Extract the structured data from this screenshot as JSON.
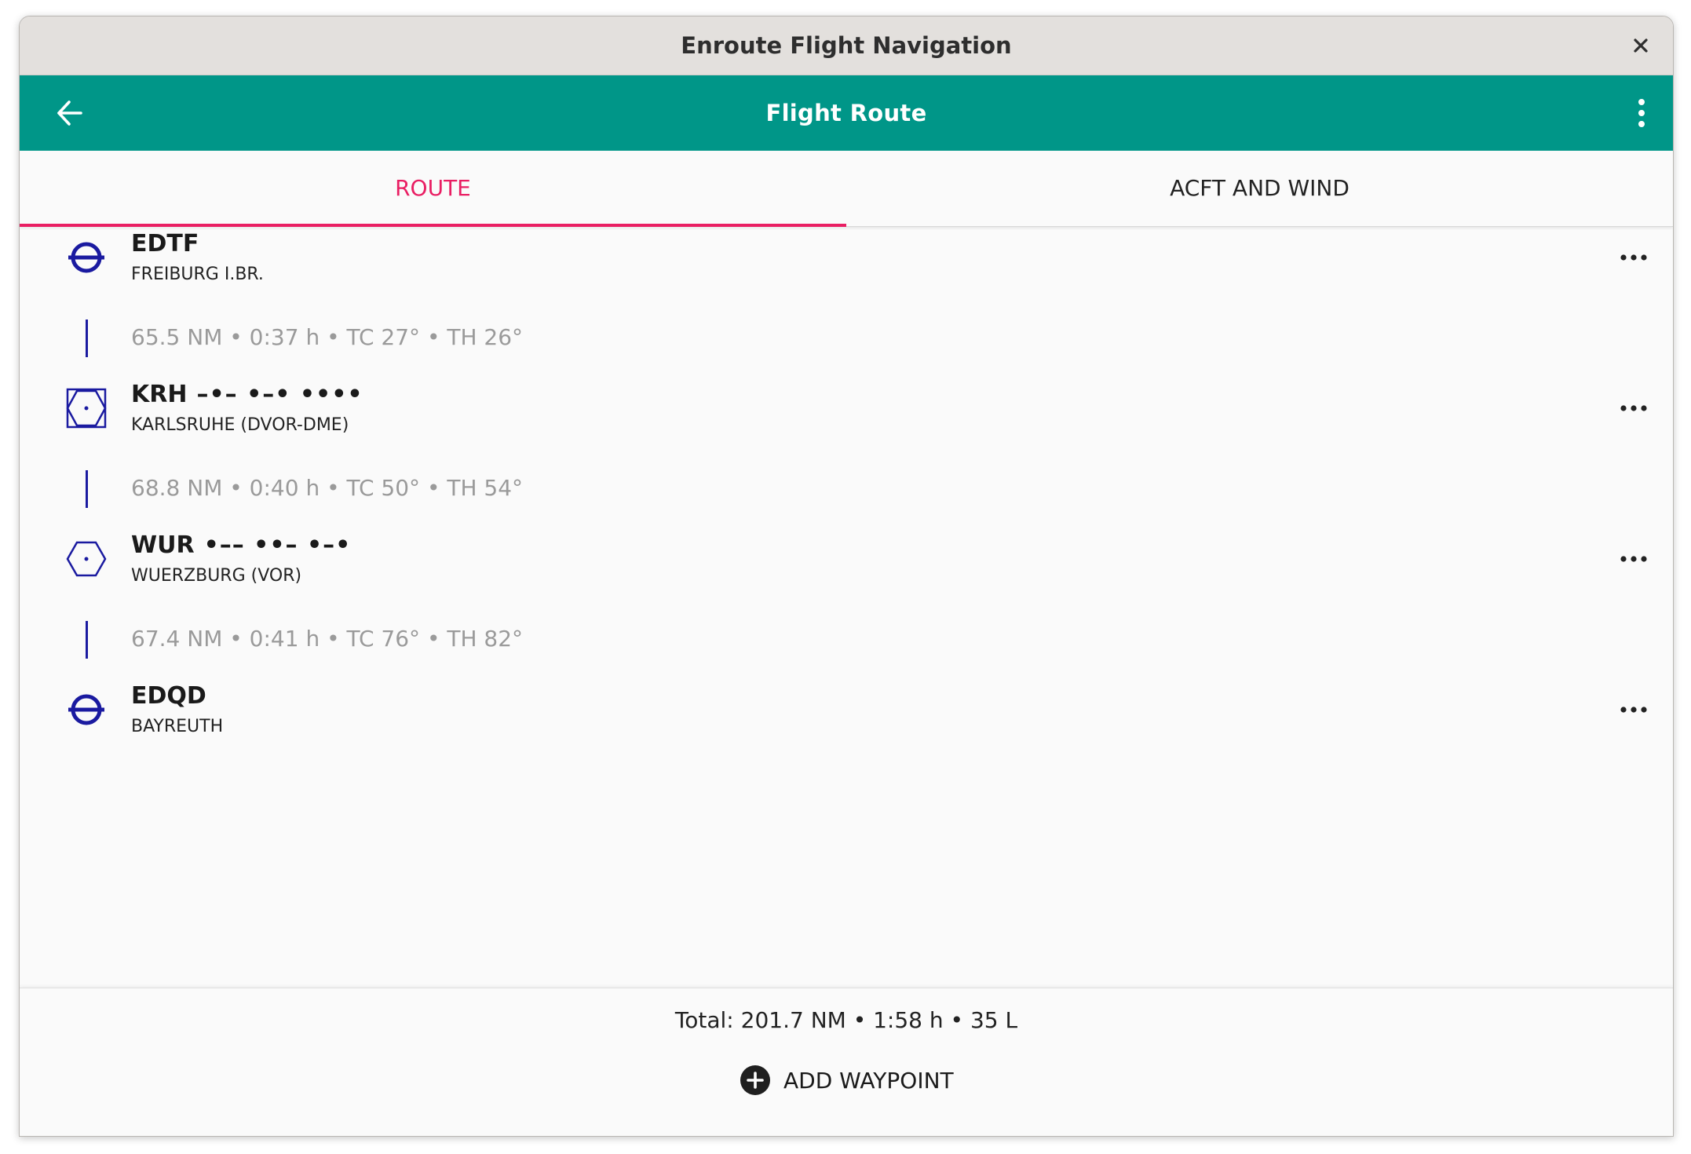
{
  "window": {
    "title": "Enroute Flight Navigation"
  },
  "appbar": {
    "title": "Flight Route"
  },
  "tabs": [
    {
      "label": "ROUTE",
      "active": true
    },
    {
      "label": "ACFT AND WIND",
      "active": false
    }
  ],
  "waypoints": [
    {
      "code": "EDTF",
      "morse": "",
      "name": "FREIBURG I.BR.",
      "icon": "airfield-icon"
    },
    {
      "code": "KRH",
      "morse": "–•– •–• ••••",
      "name": "KARLSRUHE (DVOR-DME)",
      "icon": "vor-dme-icon"
    },
    {
      "code": "WUR",
      "morse": "•–– ••– •–•",
      "name": "WUERZBURG (VOR)",
      "icon": "vor-icon"
    },
    {
      "code": "EDQD",
      "morse": "",
      "name": "BAYREUTH",
      "icon": "airfield-icon"
    }
  ],
  "legs": [
    {
      "text": "65.5 NM • 0:37 h • TC 27° • TH 26°"
    },
    {
      "text": "68.8 NM • 0:40 h • TC 50° • TH 54°"
    },
    {
      "text": "67.4 NM • 0:41 h • TC 76° • TH 82°"
    }
  ],
  "footer": {
    "total": "Total: 201.7 NM • 1:58 h • 35 L",
    "add_waypoint": "ADD WAYPOINT"
  },
  "colors": {
    "appbar": "#009688",
    "accent": "#e91e63",
    "icon": "#1a1aa0"
  }
}
